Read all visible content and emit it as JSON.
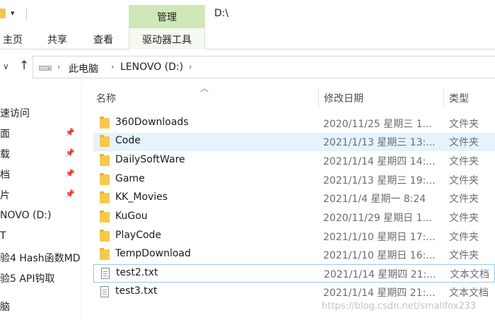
{
  "title_bar": {
    "dropdown_glyph": "▾",
    "contextual_tab": "管理",
    "path": "D:\\"
  },
  "ribbon": {
    "tabs": [
      "主页",
      "共享",
      "查看"
    ],
    "drive_tools": "驱动器工具"
  },
  "address_bar": {
    "crumbs": [
      "此电脑",
      "LENOVO (D:)"
    ]
  },
  "nav_pane": {
    "items": [
      {
        "label": "速访问",
        "pinned": false
      },
      {
        "label": "面",
        "pinned": true
      },
      {
        "label": "载",
        "pinned": true
      },
      {
        "label": "档",
        "pinned": true
      },
      {
        "label": "片",
        "pinned": true
      },
      {
        "label": "NOVO (D:)",
        "pinned": false
      },
      {
        "label": "T",
        "pinned": false
      },
      {
        "label": "验4 Hash函数MD",
        "pinned": false
      },
      {
        "label": "验5 API钩取",
        "pinned": false
      },
      {
        "label": "",
        "pinned": false
      },
      {
        "label": "脑",
        "pinned": false
      }
    ]
  },
  "columns": {
    "name": "名称",
    "date": "修改日期",
    "type": "类型"
  },
  "files": [
    {
      "name": "360Downloads",
      "date": "2020/11/25 星期三 1...",
      "type": "文件夹",
      "kind": "folder"
    },
    {
      "name": "Code",
      "date": "2021/1/13 星期三 13:...",
      "type": "文件夹",
      "kind": "folder"
    },
    {
      "name": "DailySoftWare",
      "date": "2021/1/14 星期四 14:...",
      "type": "文件夹",
      "kind": "folder"
    },
    {
      "name": "Game",
      "date": "2021/1/13 星期三 19:...",
      "type": "文件夹",
      "kind": "folder"
    },
    {
      "name": "KK_Movies",
      "date": "2021/1/4 星期一 8:24",
      "type": "文件夹",
      "kind": "folder"
    },
    {
      "name": "KuGou",
      "date": "2020/11/29 星期日 1...",
      "type": "文件夹",
      "kind": "folder"
    },
    {
      "name": "PlayCode",
      "date": "2021/1/10 星期日 17:...",
      "type": "文件夹",
      "kind": "folder"
    },
    {
      "name": "TempDownload",
      "date": "2021/1/10 星期日 16:...",
      "type": "文件夹",
      "kind": "folder"
    },
    {
      "name": "test2.txt",
      "date": "2021/1/14 星期四 21:...",
      "type": "文本文档",
      "kind": "text"
    },
    {
      "name": "test3.txt",
      "date": "2021/1/14 星期四 21:...",
      "type": "文本文档",
      "kind": "text"
    }
  ],
  "selected_file": "Code",
  "focused_file": "test2.txt",
  "watermark": "https://blog.csdn.net/smallfox233",
  "colors": {
    "accent_tab": "#cfe8b8",
    "selection": "#e5f3ff",
    "folder": "#f7c84c"
  }
}
